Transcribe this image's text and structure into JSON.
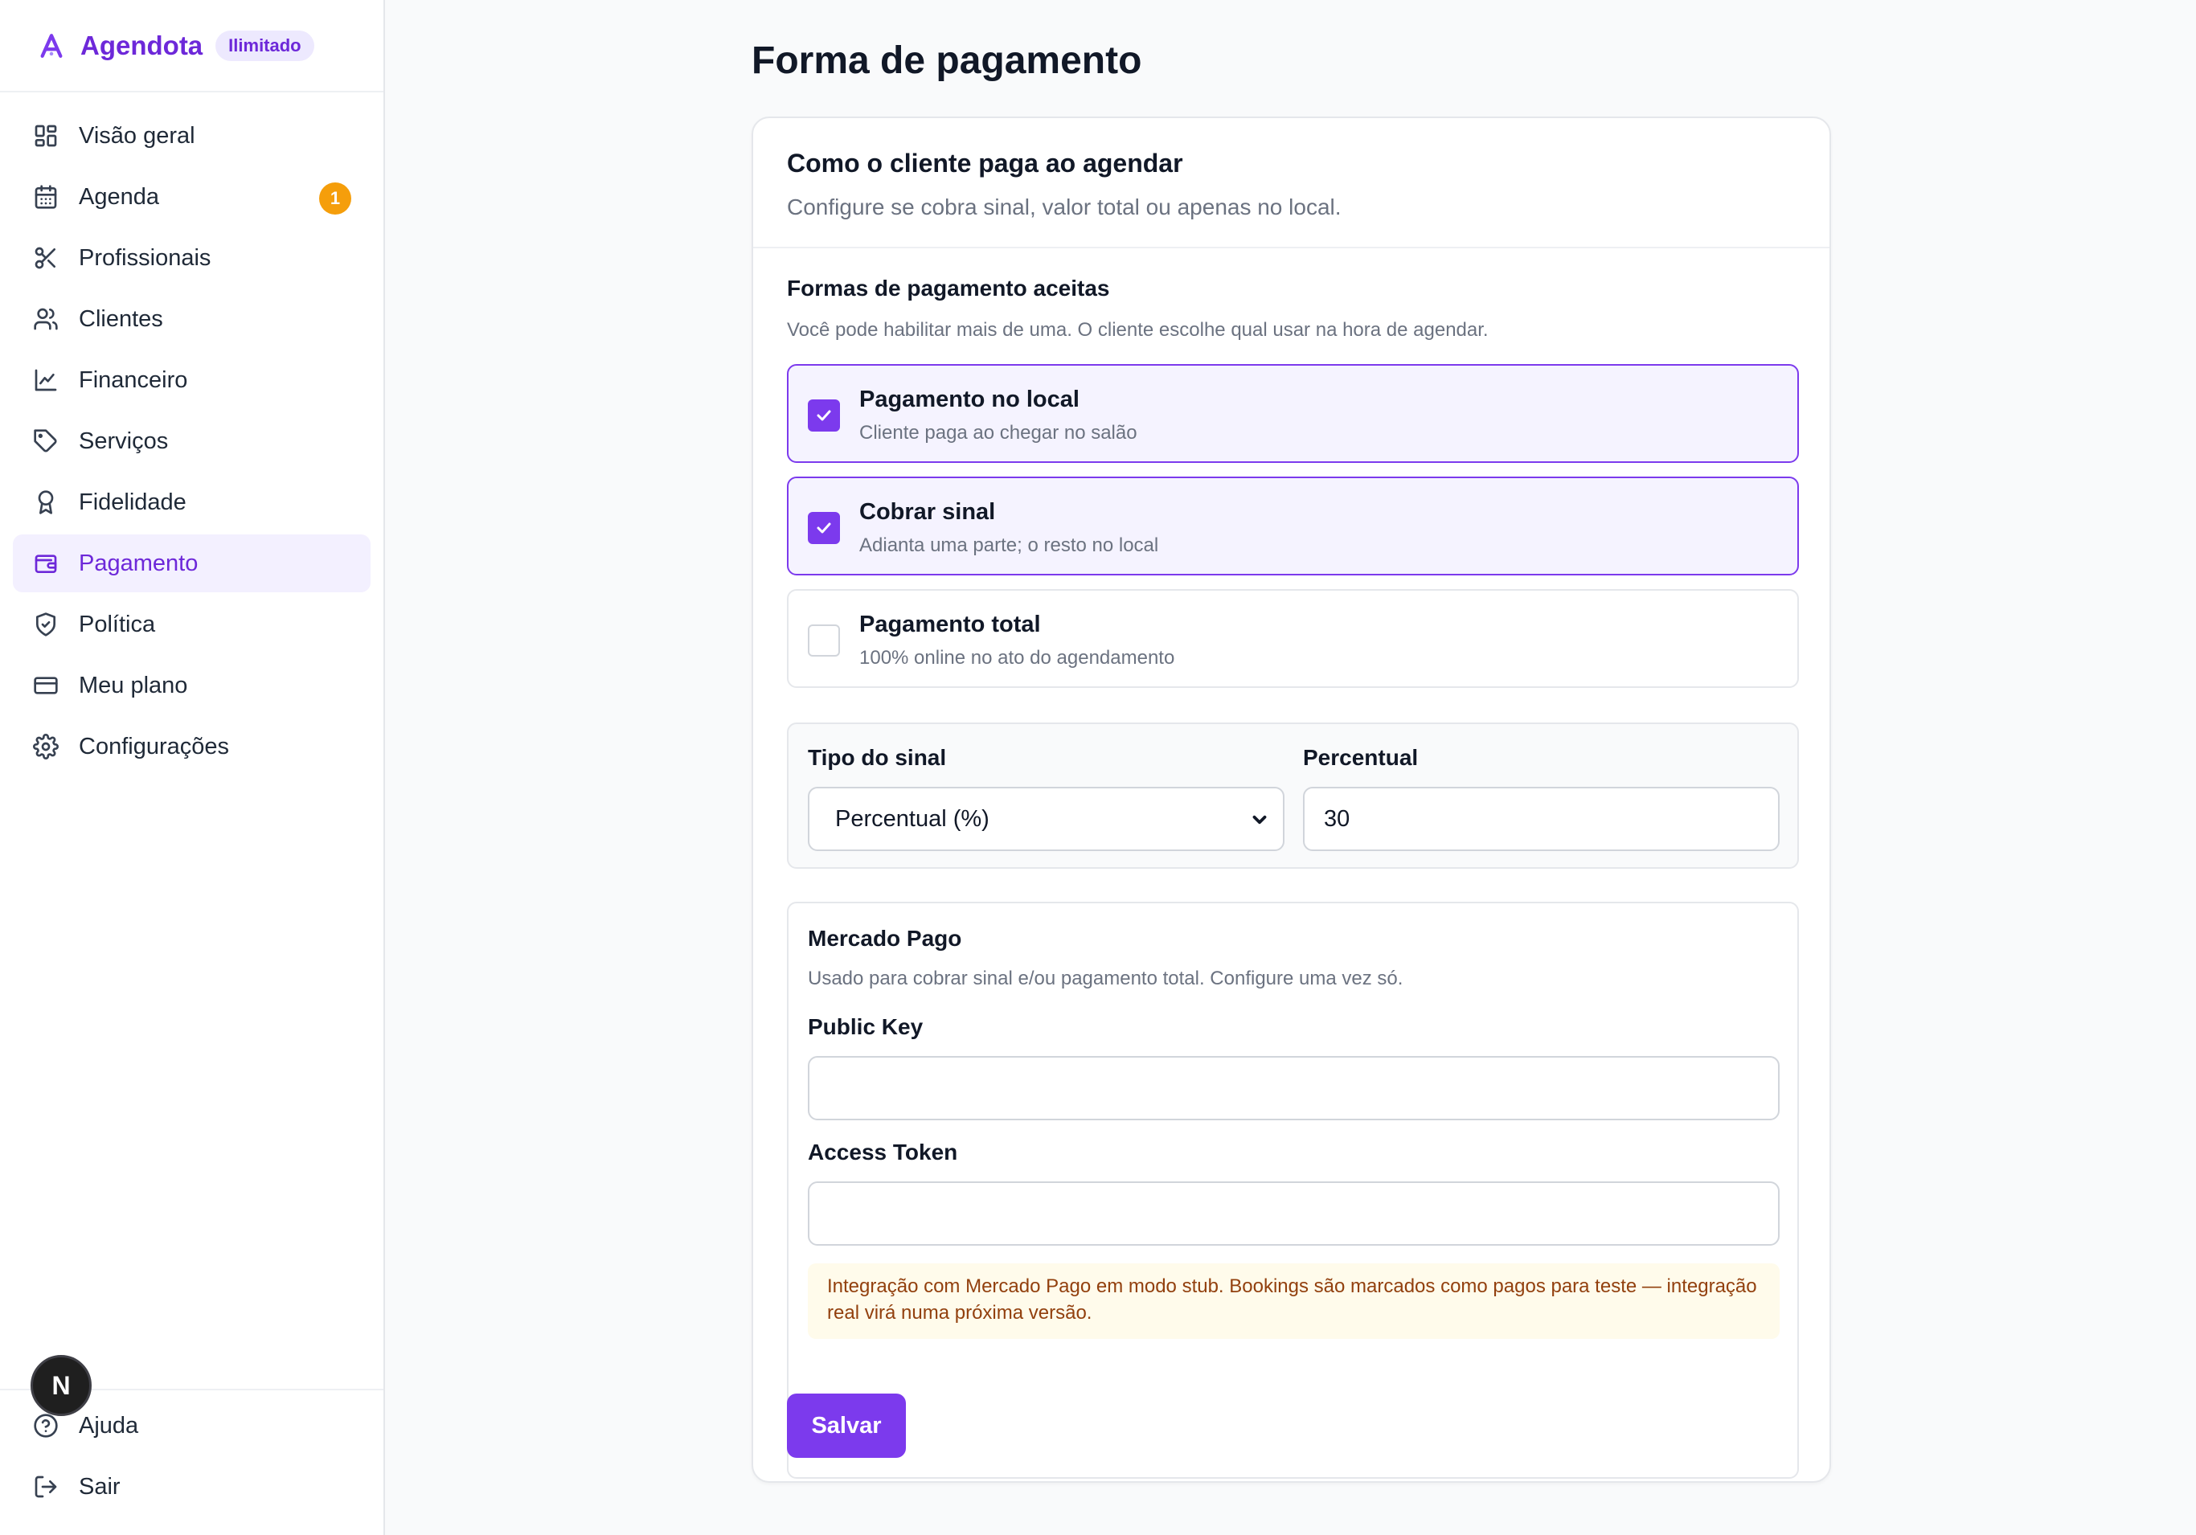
{
  "brand": {
    "name": "Agendota",
    "badge": "Ilimitado",
    "accent": "#7c3aed"
  },
  "sidebar": {
    "items": [
      {
        "label": "Visão geral",
        "icon": "layout-grid-icon"
      },
      {
        "label": "Agenda",
        "icon": "calendar-icon",
        "badge": "1"
      },
      {
        "label": "Profissionais",
        "icon": "scissors-icon"
      },
      {
        "label": "Clientes",
        "icon": "users-icon"
      },
      {
        "label": "Financeiro",
        "icon": "line-chart-icon"
      },
      {
        "label": "Serviços",
        "icon": "tag-icon"
      },
      {
        "label": "Fidelidade",
        "icon": "award-icon"
      },
      {
        "label": "Pagamento",
        "icon": "wallet-icon",
        "active": true
      },
      {
        "label": "Política",
        "icon": "shield-check-icon"
      },
      {
        "label": "Meu plano",
        "icon": "credit-card-icon"
      },
      {
        "label": "Configurações",
        "icon": "gear-icon"
      }
    ],
    "bottom": [
      {
        "label": "Ajuda",
        "icon": "help-circle-icon"
      },
      {
        "label": "Sair",
        "icon": "logout-icon"
      }
    ],
    "avatar_letter": "N"
  },
  "page": {
    "title": "Forma de pagamento"
  },
  "card": {
    "title": "Como o cliente paga ao agendar",
    "subtitle": "Configure se cobra sinal, valor total ou apenas no local.",
    "methods": {
      "title": "Formas de pagamento aceitas",
      "subtitle": "Você pode habilitar mais de uma. O cliente escolhe qual usar na hora de agendar.",
      "options": [
        {
          "title": "Pagamento no local",
          "desc": "Cliente paga ao chegar no salão",
          "checked": true
        },
        {
          "title": "Cobrar sinal",
          "desc": "Adianta uma parte; o resto no local",
          "checked": true
        },
        {
          "title": "Pagamento total",
          "desc": "100% online no ato do agendamento",
          "checked": false
        }
      ]
    },
    "signal": {
      "type_label": "Tipo do sinal",
      "type_value": "Percentual (%)",
      "percent_label": "Percentual",
      "percent_value": "30"
    },
    "mercado_pago": {
      "title": "Mercado Pago",
      "subtitle": "Usado para cobrar sinal e/ou pagamento total. Configure uma vez só.",
      "public_key_label": "Public Key",
      "public_key_value": "",
      "access_token_label": "Access Token",
      "access_token_value": "",
      "warning": "Integração com Mercado Pago em modo stub. Bookings são marcados como pagos para teste — integração real virá numa próxima versão."
    },
    "save_label": "Salvar"
  }
}
